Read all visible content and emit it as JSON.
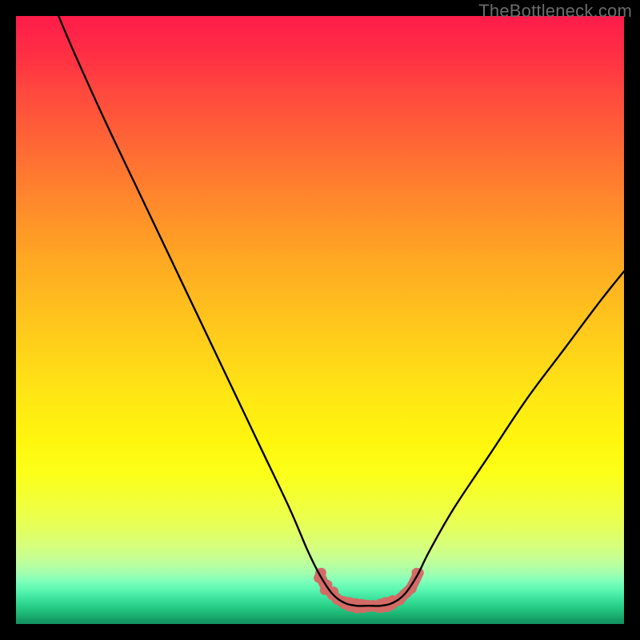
{
  "watermark": "TheBottleneck.com",
  "chart_data": {
    "type": "line",
    "title": "",
    "xlabel": "",
    "ylabel": "",
    "xlim": [
      0,
      100
    ],
    "ylim": [
      0,
      100
    ],
    "series": [
      {
        "name": "main-curve",
        "color": "#000000",
        "points": [
          {
            "x": 7.0,
            "y": 100.0
          },
          {
            "x": 10.0,
            "y": 93.0
          },
          {
            "x": 15.0,
            "y": 82.0
          },
          {
            "x": 20.0,
            "y": 71.5
          },
          {
            "x": 25.0,
            "y": 61.0
          },
          {
            "x": 30.0,
            "y": 50.5
          },
          {
            "x": 35.0,
            "y": 40.0
          },
          {
            "x": 40.0,
            "y": 29.5
          },
          {
            "x": 45.0,
            "y": 19.0
          },
          {
            "x": 48.0,
            "y": 12.0
          },
          {
            "x": 50.0,
            "y": 8.0
          },
          {
            "x": 52.0,
            "y": 5.0
          },
          {
            "x": 54.0,
            "y": 3.5
          },
          {
            "x": 56.0,
            "y": 3.0
          },
          {
            "x": 58.0,
            "y": 3.0
          },
          {
            "x": 60.0,
            "y": 3.0
          },
          {
            "x": 62.0,
            "y": 3.5
          },
          {
            "x": 64.0,
            "y": 5.0
          },
          {
            "x": 66.0,
            "y": 8.0
          },
          {
            "x": 68.0,
            "y": 12.0
          },
          {
            "x": 72.0,
            "y": 19.0
          },
          {
            "x": 78.0,
            "y": 28.0
          },
          {
            "x": 84.0,
            "y": 37.0
          },
          {
            "x": 90.0,
            "y": 45.0
          },
          {
            "x": 96.0,
            "y": 53.0
          },
          {
            "x": 100.0,
            "y": 58.0
          }
        ]
      }
    ],
    "red_band": {
      "name": "bottom-highlight",
      "color": "#d36a66",
      "points": [
        {
          "x": 50.0,
          "y": 8.0
        },
        {
          "x": 51.0,
          "y": 6.0
        },
        {
          "x": 52.0,
          "y": 5.0
        },
        {
          "x": 53.0,
          "y": 4.0
        },
        {
          "x": 54.0,
          "y": 3.5
        },
        {
          "x": 55.0,
          "y": 3.2
        },
        {
          "x": 56.0,
          "y": 3.0
        },
        {
          "x": 57.0,
          "y": 3.0
        },
        {
          "x": 58.0,
          "y": 3.0
        },
        {
          "x": 59.0,
          "y": 3.0
        },
        {
          "x": 60.0,
          "y": 3.0
        },
        {
          "x": 61.0,
          "y": 3.2
        },
        {
          "x": 62.0,
          "y": 3.5
        },
        {
          "x": 63.0,
          "y": 4.0
        },
        {
          "x": 64.0,
          "y": 5.0
        },
        {
          "x": 65.0,
          "y": 6.0
        },
        {
          "x": 66.0,
          "y": 8.0
        }
      ]
    }
  }
}
